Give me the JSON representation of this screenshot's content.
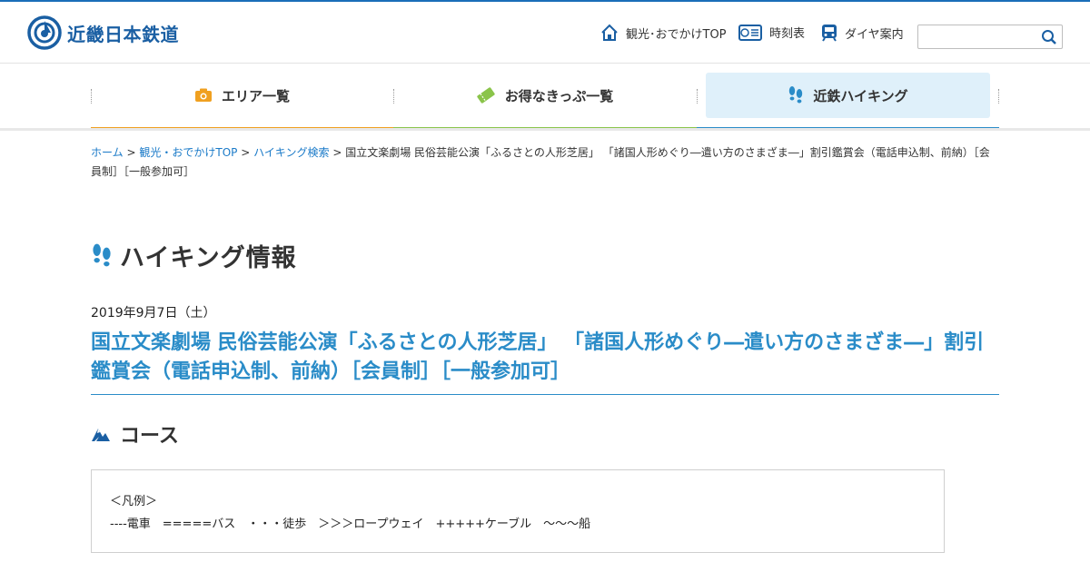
{
  "header": {
    "logo_text": "近畿日本鉄道",
    "util_links": [
      {
        "label": "観光･おでかけTOP",
        "icon": "house-icon"
      },
      {
        "label": "時刻表",
        "icon": "timetable-icon"
      },
      {
        "label": "ダイヤ案内",
        "icon": "train-icon"
      }
    ],
    "search": {
      "placeholder": "",
      "value": ""
    }
  },
  "gnav": {
    "items": [
      {
        "label": "エリア一覧",
        "icon": "camera-icon",
        "bar_color": "#f0a020"
      },
      {
        "label": "お得なきっぷ一覧",
        "icon": "ticket-icon",
        "bar_color": "#8ac44a"
      },
      {
        "label": "近鉄ハイキング",
        "icon": "footprints-icon",
        "bar_color": "#2a8cc8",
        "active": true
      }
    ]
  },
  "breadcrumb": {
    "links": [
      "ホーム",
      "観光・おでかけTOP",
      "ハイキング検索"
    ],
    "separator": ">",
    "current": "国立文楽劇場 民俗芸能公演「ふるさとの人形芝居」 「諸国人形めぐり―遣い方のさまざま―」割引鑑賞会（電話申込制、前納）［会員制］［一般参加可］"
  },
  "page": {
    "title": "ハイキング情報",
    "date": "2019年9月7日（土）",
    "event_title": "国立文楽劇場 民俗芸能公演「ふるさとの人形芝居」 「諸国人形めぐり―遣い方のさまざま―」割引鑑賞会（電話申込制、前納）［会員制］［一般参加可］"
  },
  "course": {
    "heading": "コース",
    "legend_title": "＜凡例＞",
    "legend_line": "----電車　=====バス　・・・徒歩　＞＞＞ロープウェイ　+++++ケーブル　〜〜〜船"
  },
  "colors": {
    "brand_blue": "#1a5fa3",
    "link_blue": "#1a7ac8",
    "title_blue": "#2a8cc8",
    "active_tab_bg": "#dff0fa"
  }
}
